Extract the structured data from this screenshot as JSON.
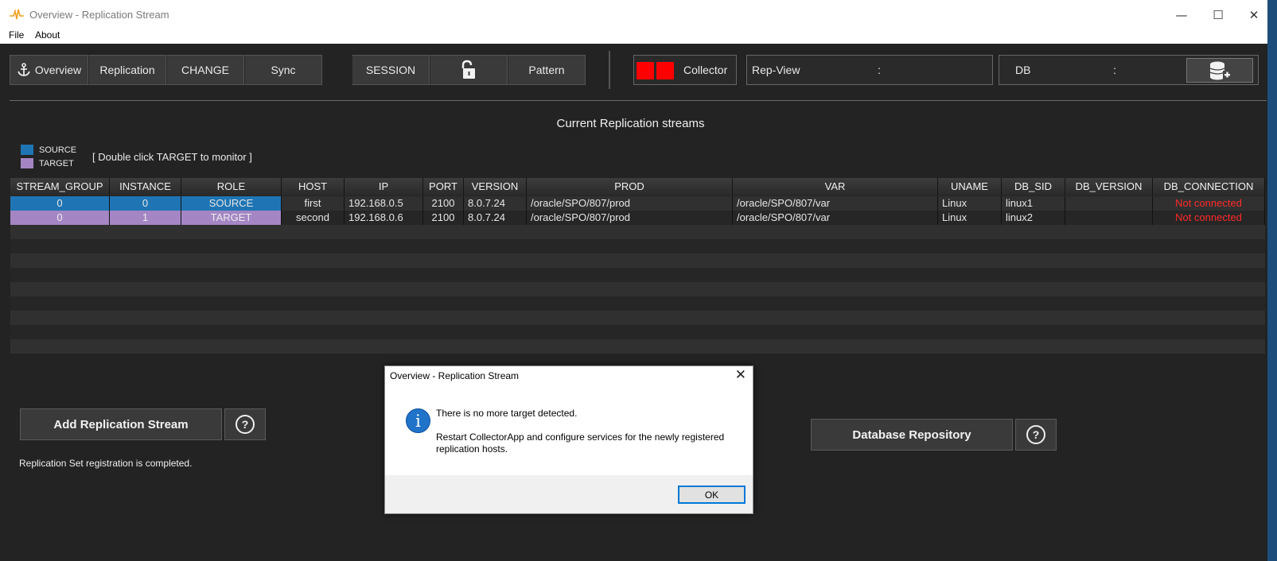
{
  "window": {
    "title": "Overview - Replication Stream"
  },
  "menu": {
    "items": [
      "File",
      "About"
    ]
  },
  "toolbar": {
    "overview_label": "Overview",
    "replication_label": "Replication",
    "change_label": "CHANGE",
    "sync_label": "Sync",
    "session_label": "SESSION",
    "pattern_label": "Pattern",
    "collector_label": "Collector",
    "repview_label": "Rep-View",
    "repview_sep": ":",
    "db_label": "DB",
    "db_sep": ":"
  },
  "main": {
    "section_title": "Current Replication streams",
    "legend": {
      "source": "SOURCE",
      "target": "TARGET"
    },
    "hint": "[ Double click TARGET to monitor ]",
    "columns": [
      "STREAM_GROUP",
      "INSTANCE",
      "ROLE",
      "HOST",
      "IP",
      "PORT",
      "VERSION",
      "PROD",
      "VAR",
      "UNAME",
      "DB_SID",
      "DB_VERSION",
      "DB_CONNECTION"
    ],
    "rows": [
      [
        "0",
        "0",
        "SOURCE",
        "first",
        "192.168.0.5",
        "2100",
        "8.0.7.24",
        "/oracle/SPO/807/prod",
        "/oracle/SPO/807/var",
        "Linux",
        "linux1",
        "",
        "Not connected"
      ],
      [
        "0",
        "1",
        "TARGET",
        "second",
        "192.168.0.6",
        "2100",
        "8.0.7.24",
        "/oracle/SPO/807/prod",
        "/oracle/SPO/807/var",
        "Linux",
        "linux2",
        "",
        "Not connected"
      ]
    ],
    "add_stream_label": "Add Replication Stream",
    "help_label": "?",
    "db_repo_label": "Database Repository",
    "status_message": "Replication Set registration is completed."
  },
  "dialog": {
    "title": "Overview - Replication Stream",
    "message1": "There is no more target detected.",
    "message2": "Restart CollectorApp and configure services for the newly registered replication hosts.",
    "ok_label": "OK"
  },
  "colors": {
    "source": "#1f75b4",
    "target": "#a586c4",
    "not_connected": "#ff2a2a",
    "collector_status": "#ff0000",
    "info_icon": "#1f73c9"
  },
  "icons": [
    "app-pulse-icon",
    "minimize-icon",
    "maximize-icon",
    "close-icon",
    "anchor-icon",
    "unlock-icon",
    "database-add-icon",
    "help-icon",
    "info-icon"
  ]
}
